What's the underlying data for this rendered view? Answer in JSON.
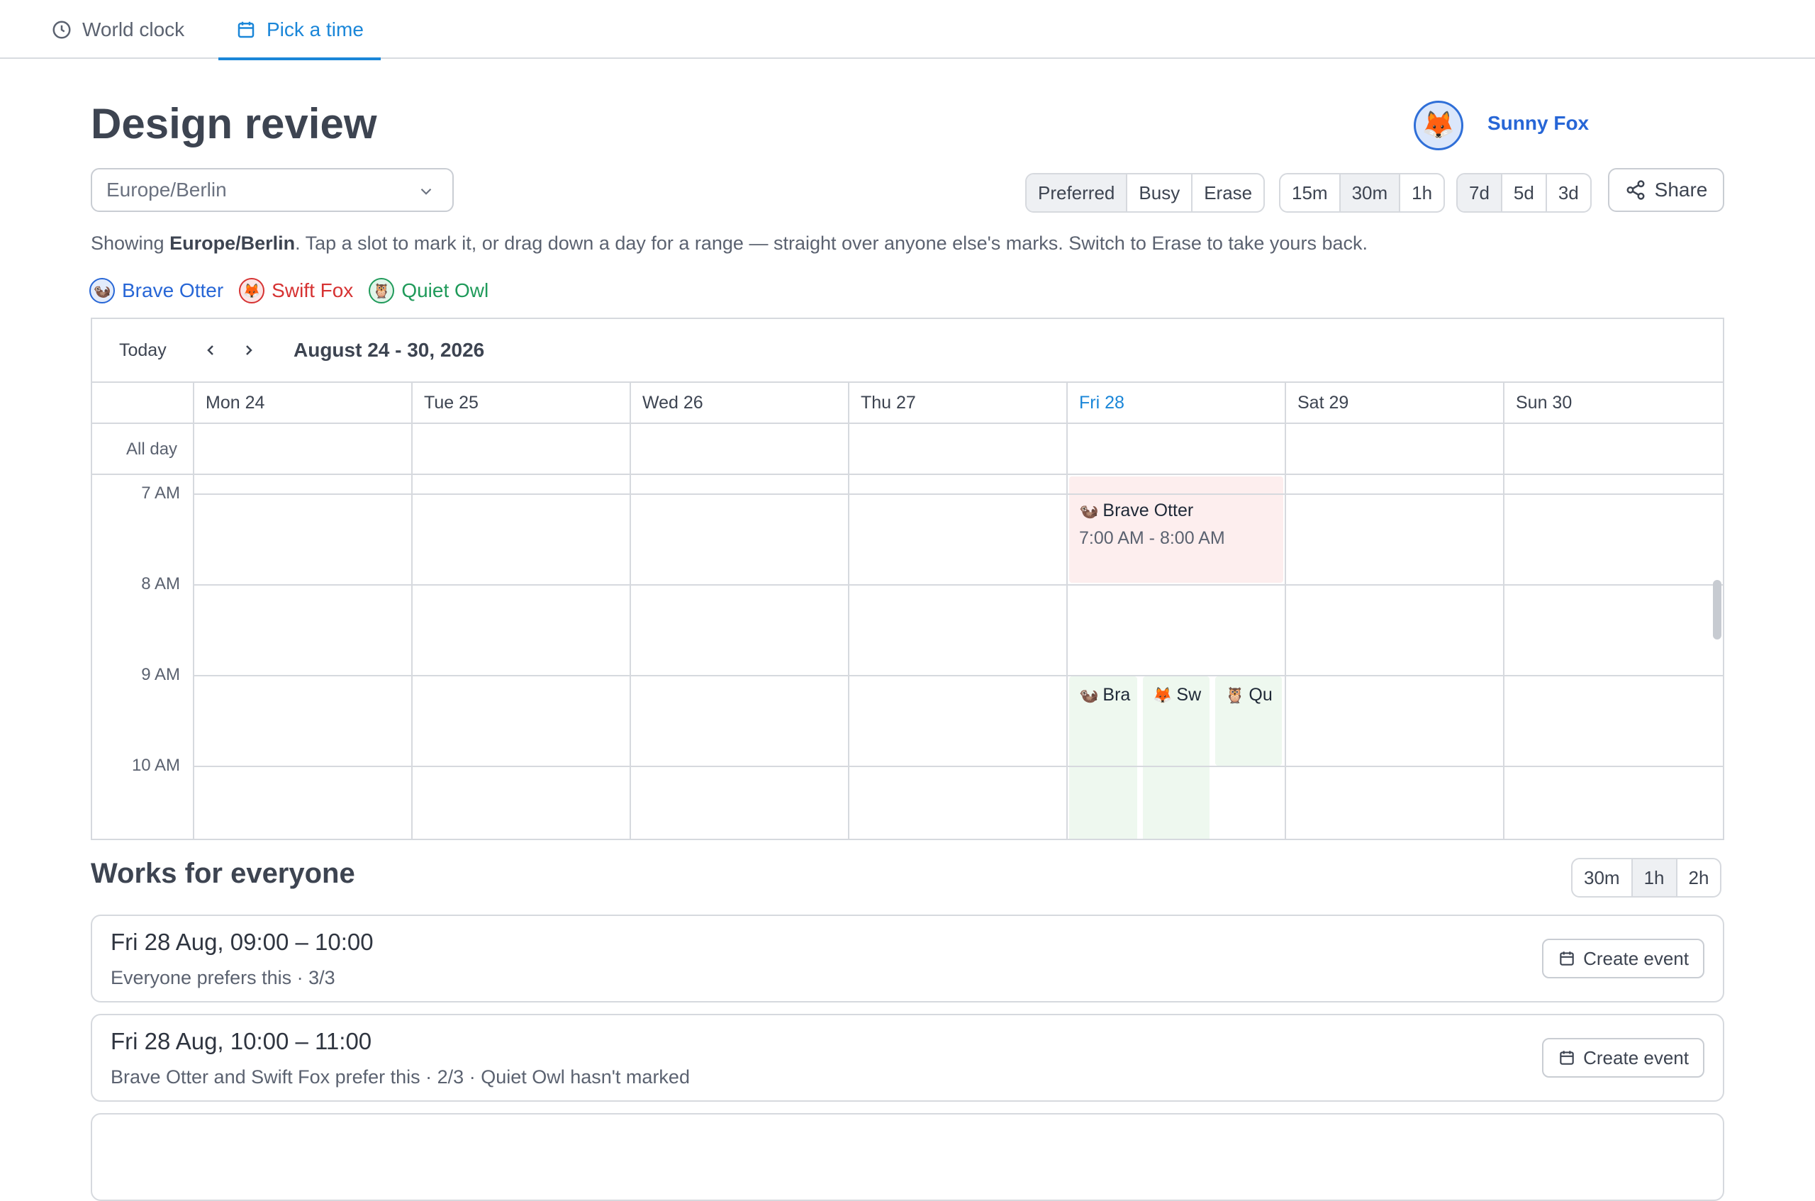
{
  "tabs": [
    {
      "label": "World clock",
      "icon": "clock-icon",
      "active": false
    },
    {
      "label": "Pick a time",
      "icon": "calendar-icon",
      "active": true
    }
  ],
  "page": {
    "title": "Design review",
    "timezone": "Europe/Berlin",
    "hint_prefix": "Showing ",
    "hint_tz": "Europe/Berlin",
    "hint_rest": ". Tap a slot to mark it, or drag down a day for a range — straight over anyone else's marks. Switch to Erase to take yours back."
  },
  "user": {
    "name": "Sunny Fox",
    "emoji": "🦊"
  },
  "mode_options": [
    {
      "label": "Preferred",
      "selected": true
    },
    {
      "label": "Busy",
      "selected": false
    },
    {
      "label": "Erase",
      "selected": false
    }
  ],
  "granularity_options": [
    {
      "label": "15m",
      "selected": false
    },
    {
      "label": "30m",
      "selected": true
    },
    {
      "label": "1h",
      "selected": false
    }
  ],
  "span_options": [
    {
      "label": "7d",
      "selected": true
    },
    {
      "label": "5d",
      "selected": false
    },
    {
      "label": "3d",
      "selected": false
    }
  ],
  "share_label": "Share",
  "participants": [
    {
      "name": "Brave Otter",
      "emoji": "🦦",
      "color": "#2766d6",
      "bg": "#e3ecfb"
    },
    {
      "name": "Swift Fox",
      "emoji": "🦊",
      "color": "#d63232",
      "bg": "#fbe5e5"
    },
    {
      "name": "Quiet Owl",
      "emoji": "🦉",
      "color": "#1f9a5a",
      "bg": "#e3f5ea"
    }
  ],
  "calendar": {
    "today_label": "Today",
    "range": "August 24 - 30, 2026",
    "allday_label": "All day",
    "days": [
      {
        "label": "Mon 24",
        "today": false
      },
      {
        "label": "Tue 25",
        "today": false
      },
      {
        "label": "Wed 26",
        "today": false
      },
      {
        "label": "Thu 27",
        "today": false
      },
      {
        "label": "Fri 28",
        "today": true
      },
      {
        "label": "Sat 29",
        "today": false
      },
      {
        "label": "Sun 30",
        "today": false
      }
    ],
    "hours": [
      "7 AM",
      "8 AM",
      "9 AM",
      "10 AM"
    ],
    "events": [
      {
        "title": "Brave Otter",
        "emoji": "🦦",
        "time": "7:00 AM - 8:00 AM",
        "kind": "busy"
      },
      {
        "title": "Bra",
        "emoji": "🦦",
        "kind": "preferred"
      },
      {
        "title": "Sw",
        "emoji": "🦊",
        "kind": "preferred"
      },
      {
        "title": "Qu",
        "emoji": "🦉",
        "kind": "preferred"
      }
    ]
  },
  "works": {
    "title": "Works for everyone",
    "durations": [
      {
        "label": "30m",
        "selected": false
      },
      {
        "label": "1h",
        "selected": true
      },
      {
        "label": "2h",
        "selected": false
      }
    ],
    "create_label": "Create event",
    "slots": [
      {
        "time": "Fri 28 Aug, 09:00 – 10:00",
        "desc": "Everyone prefers this · 3/3"
      },
      {
        "time": "Fri 28 Aug, 10:00 – 11:00",
        "desc": "Brave Otter and Swift Fox prefer this · 2/3 · Quiet Owl hasn't marked"
      }
    ]
  }
}
